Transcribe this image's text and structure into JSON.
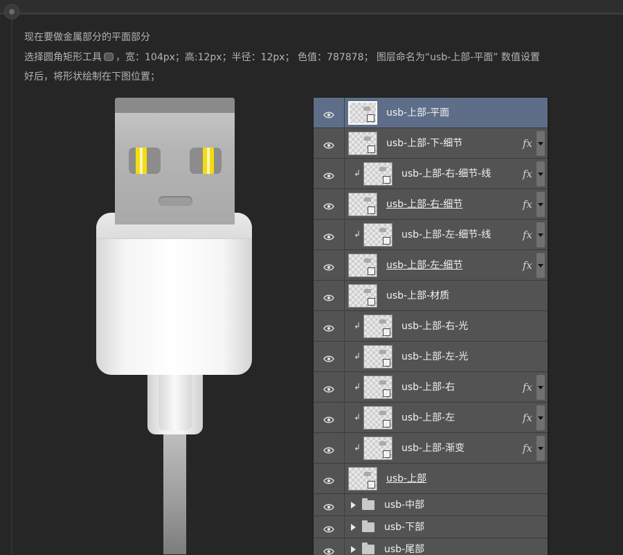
{
  "instructions": {
    "line1": "现在要做金属部分的平面部分",
    "line2_pre": "选择圆角矩形工具",
    "line2_post": "，宽：104px；高:12px；半径：12px；  色值：787878；  图层命名为“usb-上部-平面” 数值设置",
    "line3": "好后，将形状绘制在下图位置；"
  },
  "tool_icon": "rounded-rectangle-tool-icon",
  "layers": [
    {
      "name": "usb-上部-平面",
      "selected": true,
      "clipped": false,
      "fx": false,
      "underline": false
    },
    {
      "name": "usb-上部-下-细节",
      "selected": false,
      "clipped": false,
      "fx": true,
      "underline": false
    },
    {
      "name": "usb-上部-右-细节-线",
      "selected": false,
      "clipped": true,
      "fx": true,
      "underline": false
    },
    {
      "name": "usb-上部-右-细节",
      "selected": false,
      "clipped": false,
      "fx": true,
      "underline": true
    },
    {
      "name": "usb-上部-左-细节-线",
      "selected": false,
      "clipped": true,
      "fx": true,
      "underline": false
    },
    {
      "name": "usb-上部-左-细节",
      "selected": false,
      "clipped": false,
      "fx": true,
      "underline": true
    },
    {
      "name": "usb-上部-材质",
      "selected": false,
      "clipped": false,
      "fx": false,
      "underline": false
    },
    {
      "name": "usb-上部-右-光",
      "selected": false,
      "clipped": true,
      "fx": false,
      "underline": false
    },
    {
      "name": "usb-上部-左-光",
      "selected": false,
      "clipped": true,
      "fx": false,
      "underline": false
    },
    {
      "name": "usb-上部-右",
      "selected": false,
      "clipped": true,
      "fx": true,
      "underline": false
    },
    {
      "name": "usb-上部-左",
      "selected": false,
      "clipped": true,
      "fx": true,
      "underline": false
    },
    {
      "name": "usb-上部-渐变",
      "selected": false,
      "clipped": true,
      "fx": true,
      "underline": false
    },
    {
      "name": "usb-上部",
      "selected": false,
      "clipped": false,
      "fx": false,
      "underline": true
    }
  ],
  "groups": [
    {
      "name": "usb-中部"
    },
    {
      "name": "usb-下部"
    },
    {
      "name": "usb-尾部"
    }
  ],
  "fx_label": "fx",
  "clip_glyph": "↲",
  "colors": {
    "background": "#262626",
    "panel_row": "#535353",
    "selected_row": "#5e6e89",
    "contact_yellow": "#f4dd0a",
    "metal_color": "#787878"
  }
}
